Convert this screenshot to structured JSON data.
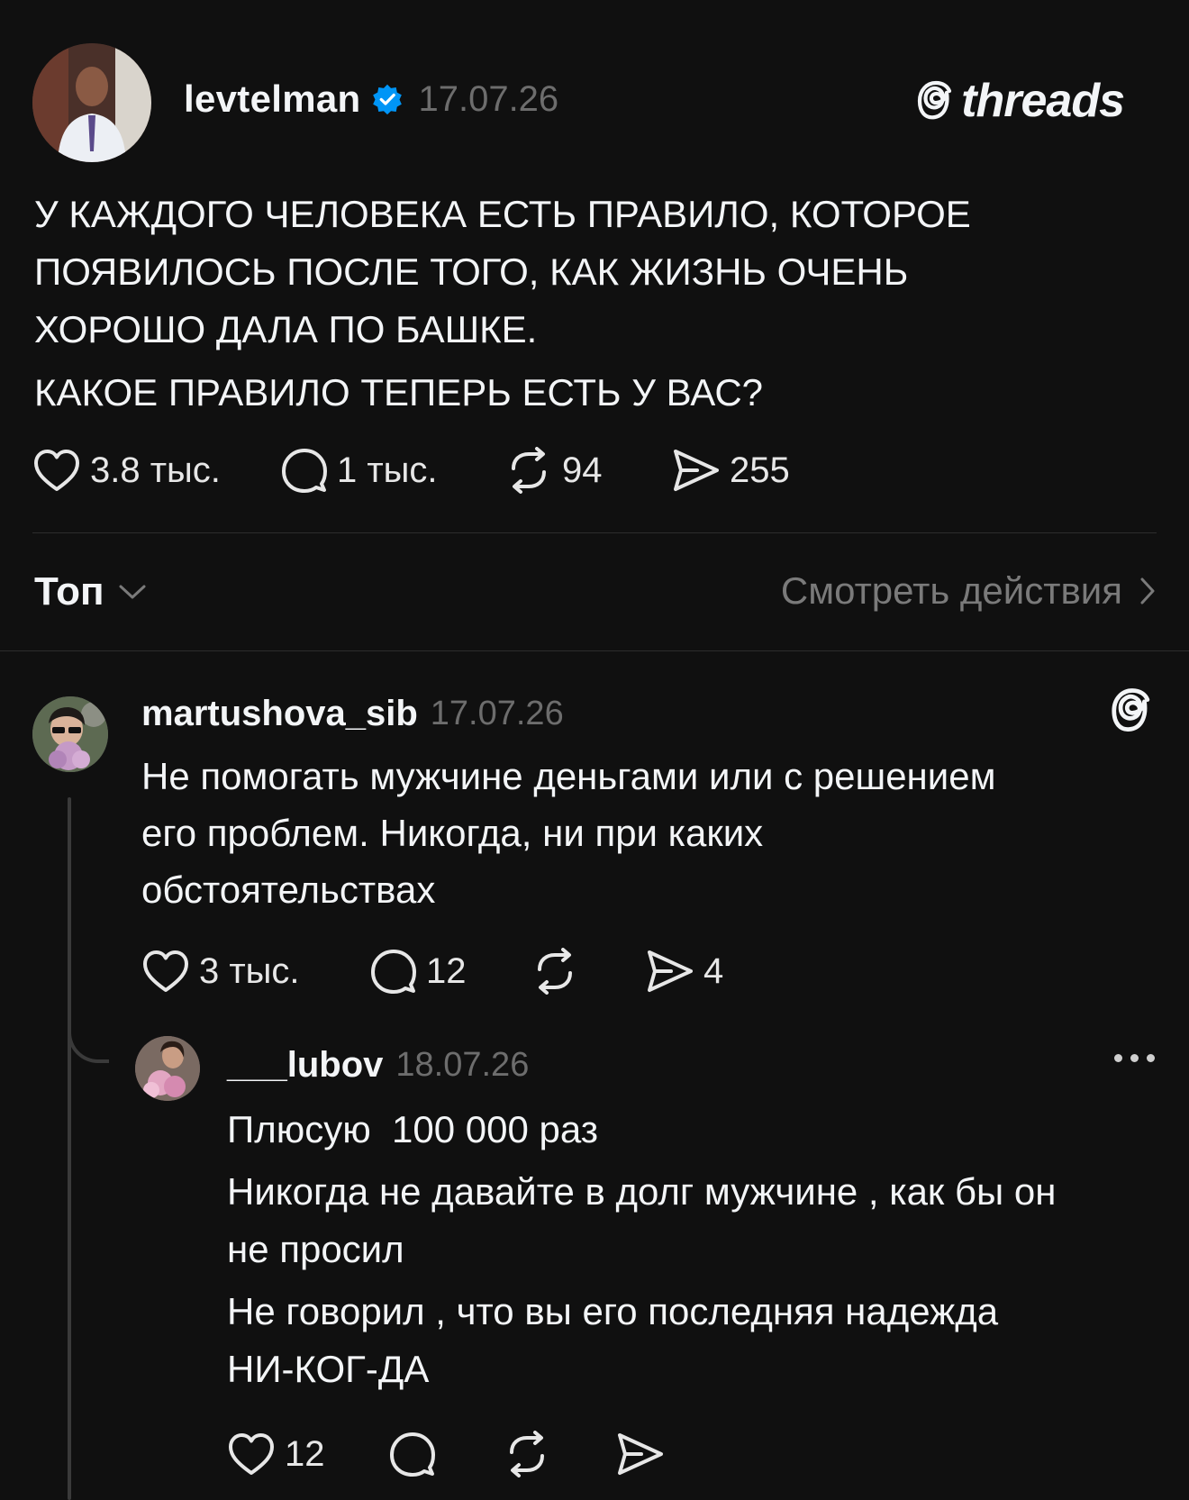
{
  "post": {
    "author": "levtelman",
    "date": "17.07.26",
    "brand": "threads",
    "text_lines": [
      "У КАЖДОГО ЧЕЛОВЕКА ЕСТЬ ПРАВИЛО, КОТОРОЕ",
      "ПОЯВИЛОСЬ ПОСЛЕ ТОГО, КАК ЖИЗНЬ ОЧЕНЬ",
      "ХОРОШО ДАЛА ПО БАШКЕ.",
      "КАКОЕ ПРАВИЛО ТЕПЕРЬ ЕСТЬ У ВАС?"
    ],
    "likes": "3.8 тыс.",
    "replies": "1 тыс.",
    "reposts": "94",
    "shares": "255"
  },
  "sort": {
    "label": "Топ",
    "view_activity": "Смотреть действия"
  },
  "comments": [
    {
      "author": "martushova_sib",
      "date": "17.07.26",
      "text_lines": [
        "Не помогать мужчине деньгами или с решением",
        "его проблем. Никогда, ни при каких",
        "обстоятельствах"
      ],
      "likes": "3 тыс.",
      "replies": "12",
      "reposts": "",
      "shares": "4"
    },
    {
      "author": "___lubov",
      "date": "18.07.26",
      "text_lines": [
        "Плюсую  100 000 раз",
        "Никогда не давайте в долг мужчине , как бы он",
        "не просил",
        "Не говорил , что вы его последняя надежда",
        "НИ-КОГ-ДА"
      ],
      "likes": "12",
      "replies": "",
      "reposts": "",
      "shares": ""
    }
  ],
  "colors": {
    "background": "#101010",
    "text": "#f3f5f7",
    "muted": "#6d6d6d",
    "verified": "#0095f6",
    "divider": "#2d2d2d"
  }
}
